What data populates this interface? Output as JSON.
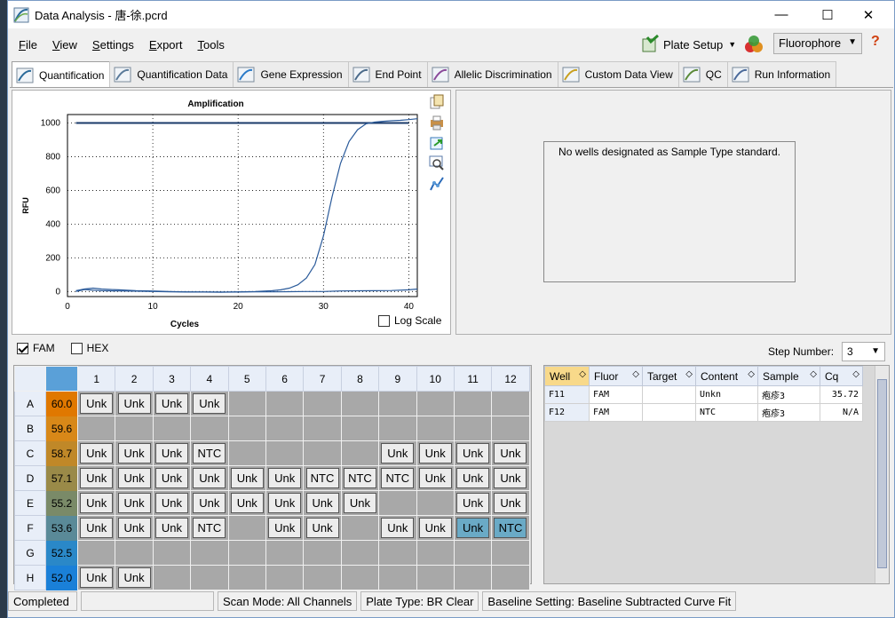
{
  "window": {
    "title": "Data Analysis - 唐-徐.pcrd",
    "minimize": "—",
    "maximize": "☐",
    "close": "✕"
  },
  "menu": [
    "File",
    "View",
    "Settings",
    "Export",
    "Tools"
  ],
  "toolbar": {
    "plate_setup": "Plate Setup",
    "fluorophore": "Fluorophore"
  },
  "tabs": [
    "Quantification",
    "Quantification Data",
    "Gene Expression",
    "End Point",
    "Allelic Discrimination",
    "Custom Data View",
    "QC",
    "Run Information"
  ],
  "chart_data": {
    "type": "line",
    "title": "Amplification",
    "xlabel": "Cycles",
    "ylabel": "RFU",
    "xlim": [
      0,
      41
    ],
    "ylim": [
      -30,
      1050
    ],
    "xticks": [
      0,
      10,
      20,
      30,
      40
    ],
    "yticks": [
      0,
      200,
      400,
      600,
      800,
      1000
    ],
    "grid": true,
    "threshold": 1000,
    "series": [
      {
        "x": [
          1,
          2,
          3,
          4,
          5,
          6,
          8,
          10,
          12,
          14,
          16,
          18,
          20,
          22,
          24,
          25,
          26,
          27,
          28,
          29,
          30,
          31,
          32,
          33,
          34,
          35,
          36,
          37,
          38,
          39,
          40,
          41
        ],
        "y": [
          5,
          15,
          20,
          15,
          12,
          10,
          5,
          3,
          0,
          -2,
          -3,
          -3,
          -2,
          0,
          5,
          10,
          20,
          40,
          80,
          160,
          330,
          560,
          760,
          890,
          960,
          995,
          1005,
          1010,
          1013,
          1016,
          1020,
          1025
        ]
      },
      {
        "x": [
          1,
          2,
          3,
          4,
          6,
          8,
          10,
          12,
          14,
          16,
          18,
          20,
          22,
          24,
          26,
          28,
          30,
          32,
          34,
          36,
          38,
          40,
          41
        ],
        "y": [
          0,
          12,
          8,
          5,
          3,
          2,
          0,
          -2,
          -3,
          -3,
          -4,
          -3,
          -2,
          -2,
          -1,
          0,
          0,
          3,
          4,
          5,
          6,
          10,
          15
        ]
      }
    ]
  },
  "log_scale": {
    "label": "Log Scale",
    "checked": false
  },
  "standard_message": "No wells designated as Sample Type standard.",
  "fluors": [
    {
      "label": "FAM",
      "checked": true
    },
    {
      "label": "HEX",
      "checked": false
    }
  ],
  "step": {
    "label": "Step Number:",
    "value": "3"
  },
  "plate": {
    "columns": [
      "1",
      "2",
      "3",
      "4",
      "5",
      "6",
      "7",
      "8",
      "9",
      "10",
      "11",
      "12"
    ],
    "rows": [
      {
        "row": "A",
        "temp": "60.0",
        "color": "#e07800",
        "wells": [
          "Unk",
          "Unk",
          "Unk",
          "Unk",
          "",
          "",
          "",
          "",
          "",
          "",
          "",
          ""
        ]
      },
      {
        "row": "B",
        "temp": "59.6",
        "color": "#d88818",
        "wells": [
          "",
          "",
          "",
          "",
          "",
          "",
          "",
          "",
          "",
          "",
          "",
          ""
        ]
      },
      {
        "row": "C",
        "temp": "58.7",
        "color": "#c08828",
        "wells": [
          "Unk",
          "Unk",
          "Unk",
          "NTC",
          "",
          "",
          "",
          "",
          "Unk",
          "Unk",
          "Unk",
          "Unk"
        ]
      },
      {
        "row": "D",
        "temp": "57.1",
        "color": "#9a8a48",
        "wells": [
          "Unk",
          "Unk",
          "Unk",
          "Unk",
          "Unk",
          "Unk",
          "NTC",
          "NTC",
          "NTC",
          "Unk",
          "Unk",
          "Unk"
        ]
      },
      {
        "row": "E",
        "temp": "55.2",
        "color": "#7a8a68",
        "wells": [
          "Unk",
          "Unk",
          "Unk",
          "Unk",
          "Unk",
          "Unk",
          "Unk",
          "Unk",
          "",
          "",
          "Unk",
          "Unk"
        ]
      },
      {
        "row": "F",
        "temp": "53.6",
        "color": "#5a8a98",
        "wells": [
          "Unk",
          "Unk",
          "Unk",
          "NTC",
          "",
          "Unk",
          "Unk",
          "",
          "Unk",
          "Unk",
          "Unk",
          "NTC"
        ]
      },
      {
        "row": "G",
        "temp": "52.5",
        "color": "#2a88c8",
        "wells": [
          "",
          "",
          "",
          "",
          "",
          "",
          "",
          "",
          "",
          "",
          "",
          ""
        ]
      },
      {
        "row": "H",
        "temp": "52.0",
        "color": "#1a80d8",
        "wells": [
          "Unk",
          "Unk",
          "",
          "",
          "",
          "",
          "",
          "",
          "",
          "",
          "",
          ""
        ]
      }
    ]
  },
  "well_table": {
    "headers": [
      "Well",
      "Fluor",
      "Target",
      "Content",
      "Sample",
      "Cq"
    ],
    "rows": [
      [
        "F11",
        "FAM",
        "",
        "Unkn",
        "疱疹3",
        "35.72"
      ],
      [
        "F12",
        "FAM",
        "",
        "NTC",
        "疱疹3",
        "N/A"
      ]
    ]
  },
  "status": [
    "Completed",
    "",
    "Scan Mode: All Channels",
    "Plate Type: BR Clear",
    "Baseline Setting: Baseline Subtracted Curve Fit"
  ]
}
